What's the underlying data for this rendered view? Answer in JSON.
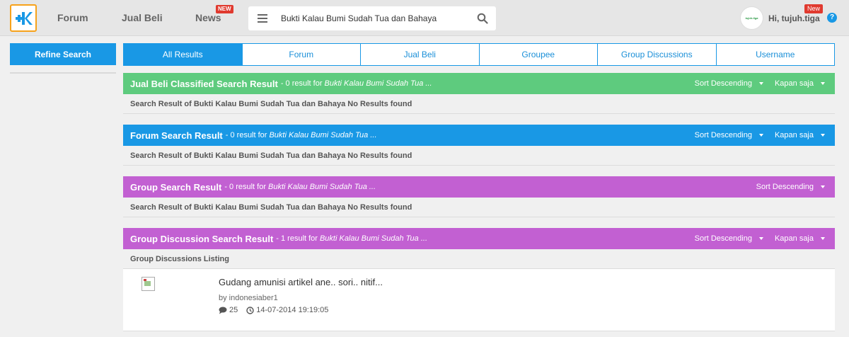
{
  "header": {
    "nav": {
      "forum": "Forum",
      "jual_beli": "Jual Beli",
      "news": "News",
      "news_badge": "NEW"
    },
    "search": {
      "value": "Bukti Kalau Bumi Sudah Tua dan Bahaya"
    },
    "user": {
      "avatar_text": "tujuh.tiga",
      "greeting": "Hi, tujuh.tiga",
      "badge": "New",
      "help": "?"
    }
  },
  "sidebar": {
    "refine_label": "Refine Search"
  },
  "tabs": [
    "All Results",
    "Forum",
    "Jual Beli",
    "Groupee",
    "Group Discussions",
    "Username"
  ],
  "colors": {
    "accent": "#1998e5",
    "green": "#5ecb7e",
    "purple": "#c260d2",
    "logo_border": "#f7a21b",
    "badge": "#e03a2f"
  },
  "sections": [
    {
      "title": "Jual Beli Classified Search Result",
      "count": "- 0 result for",
      "query": "Bukti Kalau Bumi Sudah Tua ...",
      "sort": "Sort Descending",
      "time": "Kapan saja",
      "body": "Search Result of Bukti Kalau Bumi Sudah Tua dan Bahaya No Results found"
    },
    {
      "title": "Forum Search Result",
      "count": "- 0 result for",
      "query": "Bukti Kalau Bumi Sudah Tua ...",
      "sort": "Sort Descending",
      "time": "Kapan saja",
      "body": "Search Result of Bukti Kalau Bumi Sudah Tua dan Bahaya No Results found"
    },
    {
      "title": "Group Search Result",
      "count": "- 0 result for",
      "query": "Bukti Kalau Bumi Sudah Tua ...",
      "sort": "Sort Descending",
      "body": "Search Result of Bukti Kalau Bumi Sudah Tua dan Bahaya No Results found"
    },
    {
      "title": "Group Discussion Search Result",
      "count": "- 1 result for",
      "query": "Bukti Kalau Bumi Sudah Tua ...",
      "sort": "Sort Descending",
      "time": "Kapan saja",
      "body": "Group Discussions Listing"
    }
  ],
  "listing": {
    "title": "Gudang amunisi artikel ane.. sori.. nitif...",
    "by": "by indonesiaber1",
    "comments": "25",
    "date": "14-07-2014 19:19:05",
    "comment_icon": "comment-icon",
    "clock_icon": "clock-icon"
  }
}
